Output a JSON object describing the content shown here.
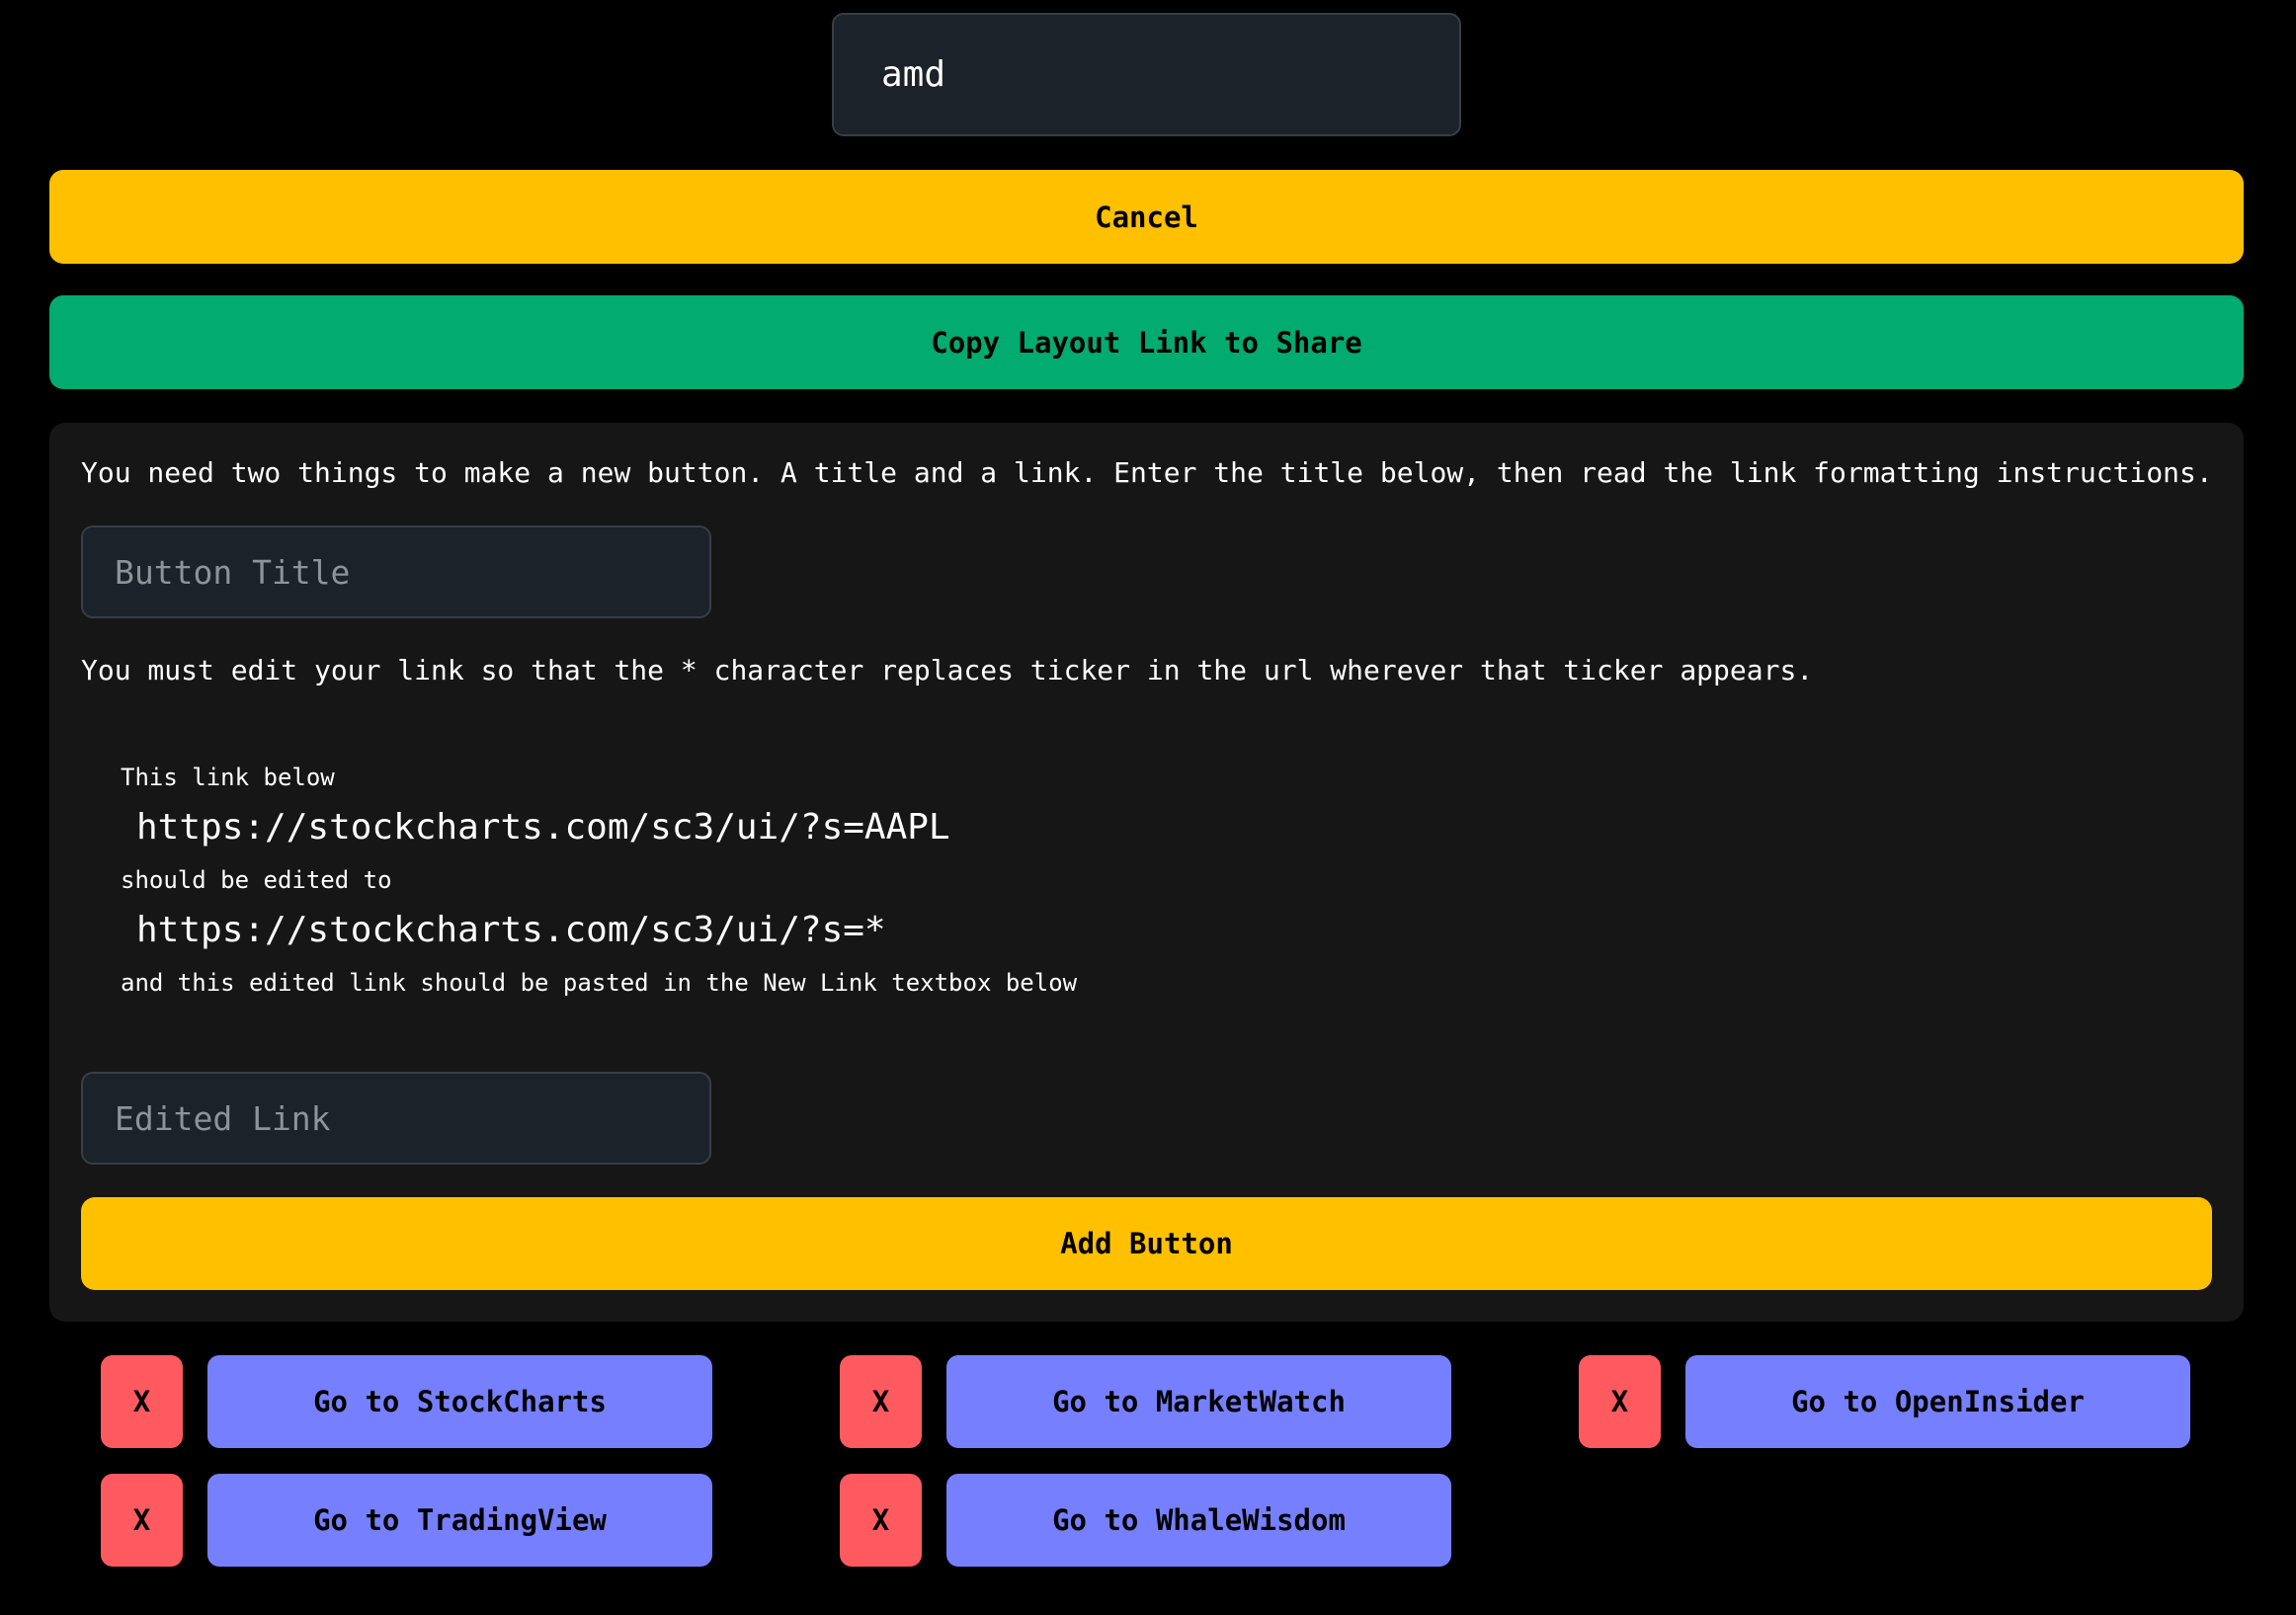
{
  "ticker_input": {
    "value": "amd"
  },
  "cancel_label": "Cancel",
  "copy_label": "Copy Layout Link to Share",
  "form": {
    "intro": "You need two things to make a new button. A title and a link. Enter the title below, then read the link formatting instructions.",
    "title_placeholder": "Button Title",
    "instructions": "You must edit your link so that the * character replaces ticker in the url wherever that ticker appears.",
    "example_label_1": "This link below",
    "example_url_before": "https://stockcharts.com/sc3/ui/?s=AAPL",
    "example_label_2": "should be edited to",
    "example_url_after": "https://stockcharts.com/sc3/ui/?s=*",
    "example_label_3": "and this edited link should be pasted in the New Link textbox below",
    "link_placeholder": "Edited Link",
    "add_label": "Add Button"
  },
  "delete_label": "X",
  "links": [
    {
      "label": "Go to StockCharts"
    },
    {
      "label": "Go to MarketWatch"
    },
    {
      "label": "Go to OpenInsider"
    },
    {
      "label": "Go to TradingView"
    },
    {
      "label": "Go to WhaleWisdom"
    }
  ],
  "colors": {
    "cancel": "#ffc000",
    "copy": "#02ab6f",
    "link": "#7680ff",
    "delete": "#ff5a5f"
  }
}
